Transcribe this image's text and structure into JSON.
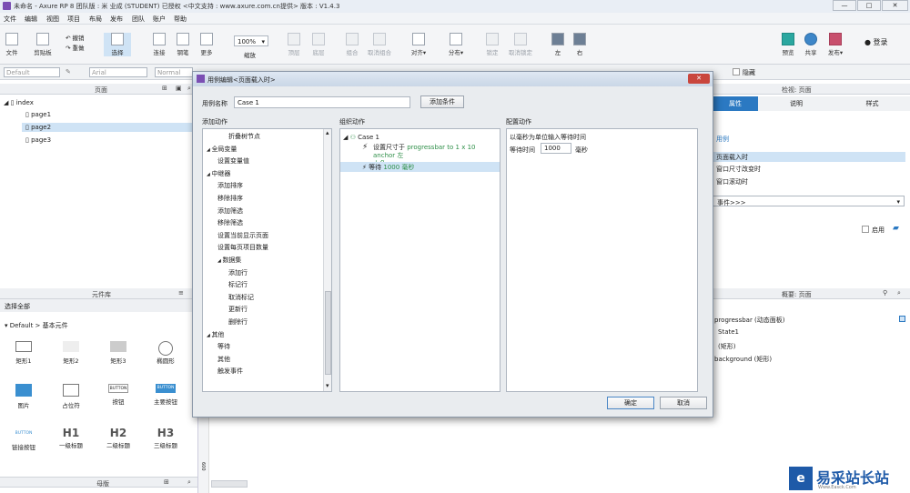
{
  "window": {
    "title": "未命名 - Axure RP 8 团队版 : 米 业成 (STUDENT) 已授权   <中文支持 : www.axure.com.cn提供> 版本 : V1.4.3"
  },
  "menu": [
    "文件",
    "编辑",
    "视图",
    "项目",
    "布局",
    "发布",
    "团队",
    "账户",
    "帮助"
  ],
  "toolbar": {
    "file": "文件",
    "clipboard": "剪贴板",
    "undo": "撤销",
    "redo": "重做",
    "select": "选择",
    "connect": "连接",
    "pen": "钢笔",
    "more": "更多",
    "zoom_value": "100%",
    "zoom_label": "缩放",
    "top": "顶层",
    "bottom": "底层",
    "group": "组合",
    "ungroup": "取消组合",
    "align": "对齐",
    "distribute": "分布",
    "lock": "锁定",
    "unlock": "取消锁定",
    "left": "左",
    "right": "右",
    "preview": "预览",
    "share": "共享",
    "publish": "发布",
    "login": "登录"
  },
  "format": {
    "style": "Default",
    "font": "Arial",
    "weight": "Normal",
    "hidden": "隐藏"
  },
  "pages": {
    "title": "页面",
    "items": [
      {
        "label": "index"
      },
      {
        "label": "page1"
      },
      {
        "label": "page2"
      },
      {
        "label": "page3"
      }
    ]
  },
  "library": {
    "title": "元件库",
    "select_all": "选择全部",
    "category": "Default > 基本元件",
    "items": [
      "矩形1",
      "矩形2",
      "矩形3",
      "椭圆形",
      "图片",
      "占位符",
      "按钮",
      "主要按钮",
      "链接按钮",
      "一级标题",
      "二级标题",
      "三级标题"
    ],
    "btn_text": "BUTTON",
    "h1": "H1",
    "h2": "H2",
    "h3": "H3"
  },
  "masters": {
    "title": "母版"
  },
  "ruler": {
    "mark": "600"
  },
  "inspector": {
    "title": "检视: 页面",
    "tabs": [
      "属性",
      "说明",
      "样式"
    ],
    "case_label": "用例",
    "events": [
      "页面载入时",
      "窗口尺寸改变时",
      "窗口滚动时"
    ],
    "more_events": "事件>>>",
    "enable": "启用"
  },
  "outline": {
    "title": "概要: 页面",
    "items": [
      "progressbar (动态面板)",
      "State1",
      "(矩形)",
      "background (矩形)"
    ]
  },
  "dialog": {
    "title": "用例编辑<页面载入时>",
    "case_name_label": "用例名称",
    "case_name": "Case 1",
    "add_condition": "添加条件",
    "col1": "添加动作",
    "col2": "组织动作",
    "col3": "配置动作",
    "actions": [
      {
        "t": "折叠树节点",
        "lvl": 2
      },
      {
        "t": "全局变量",
        "lvl": 0
      },
      {
        "t": "设置变量值",
        "lvl": 1
      },
      {
        "t": "中继器",
        "lvl": 0
      },
      {
        "t": "添加排序",
        "lvl": 1
      },
      {
        "t": "移除排序",
        "lvl": 1
      },
      {
        "t": "添加筛选",
        "lvl": 1
      },
      {
        "t": "移除筛选",
        "lvl": 1
      },
      {
        "t": "设置当前显示页面",
        "lvl": 1
      },
      {
        "t": "设置每页项目数量",
        "lvl": 1
      },
      {
        "t": "数据集",
        "lvl": 1
      },
      {
        "t": "添加行",
        "lvl": 2
      },
      {
        "t": "标记行",
        "lvl": 2
      },
      {
        "t": "取消标记",
        "lvl": 2
      },
      {
        "t": "更新行",
        "lvl": 2
      },
      {
        "t": "删除行",
        "lvl": 2
      },
      {
        "t": "其他",
        "lvl": 0
      },
      {
        "t": "等待",
        "lvl": 1
      },
      {
        "t": "其他",
        "lvl": 1
      },
      {
        "t": "触发事件",
        "lvl": 1
      }
    ],
    "org": {
      "case": "Case 1",
      "a1_prefix": "设置尺寸于",
      "a1_detail": "progressbar to 1 x 10 anchor 左",
      "a1_line2": "上角",
      "a2_prefix": "等待",
      "a2_detail": "1000 毫秒"
    },
    "config": {
      "desc": "以毫秒为单位输入等待时间",
      "wait_label": "等待时间",
      "wait_value": "1000",
      "unit": "毫秒"
    },
    "ok": "确定",
    "cancel": "取消"
  },
  "watermark": {
    "text": "易采站长站",
    "sub": "Www.Easck.Com"
  }
}
